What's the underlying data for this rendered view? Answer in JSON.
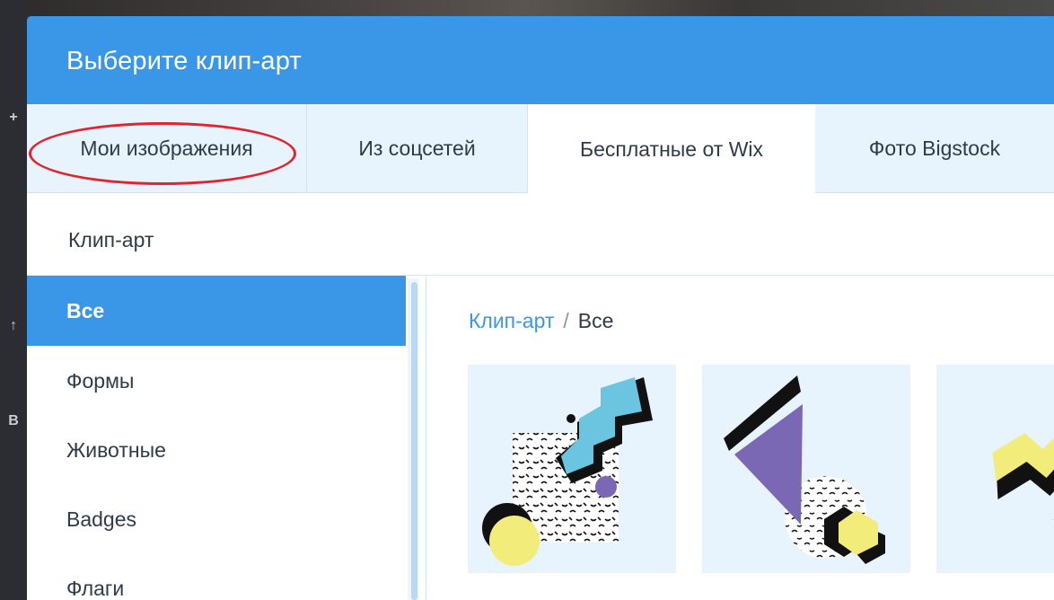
{
  "dialog": {
    "title": "Выберите клип-арт"
  },
  "tabs": [
    {
      "label": "Мои изображения",
      "active": false,
      "highlighted": true
    },
    {
      "label": "Из соцсетей",
      "active": false
    },
    {
      "label": "Бесплатные от Wix",
      "active": true
    },
    {
      "label": "Фото Bigstock",
      "active": false
    }
  ],
  "section": {
    "label": "Клип-арт"
  },
  "sidebar": {
    "items": [
      {
        "label": "Все",
        "active": true
      },
      {
        "label": "Формы"
      },
      {
        "label": "Животные"
      },
      {
        "label": "Badges"
      },
      {
        "label": "Флаги"
      }
    ]
  },
  "breadcrumb": {
    "root": "Клип-арт",
    "separator": "/",
    "current": "Все"
  },
  "colors": {
    "accent": "#3a97e8",
    "tab_background": "#e7f3fd",
    "highlight": "#e0252e",
    "clip_purple": "#7b68b5",
    "clip_yellow": "#f2ec7a",
    "clip_cyan": "#6bc5e0"
  },
  "left_toolbar_icons": [
    "plus-icon",
    "upload-icon",
    "blog-icon"
  ]
}
